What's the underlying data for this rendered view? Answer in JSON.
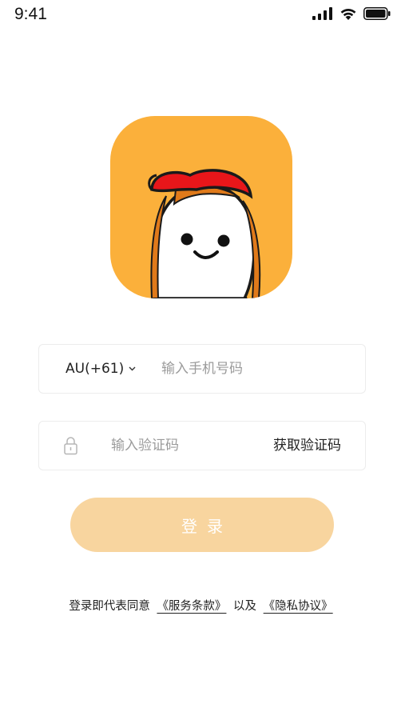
{
  "status_bar": {
    "time": "9:41"
  },
  "login": {
    "country_code": "AU(+61)",
    "phone_placeholder": "输入手机号码",
    "code_placeholder": "输入验证码",
    "get_code_label": "获取验证码",
    "submit_label": "登录",
    "agreement_prefix": "登录即代表同意",
    "terms_label": "《服务条款》",
    "agreement_connector": "以及",
    "privacy_label": "《隐私协议》"
  },
  "colors": {
    "brand": "#fbb03b",
    "cap": "#e8161a",
    "button_disabled": "#f8d59f"
  },
  "icons": [
    "signal-icon",
    "wifi-icon",
    "battery-icon",
    "chevron-down-icon",
    "lock-icon",
    "mascot-logo"
  ]
}
